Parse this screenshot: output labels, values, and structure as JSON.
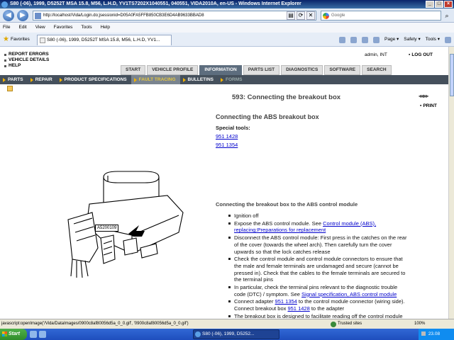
{
  "window": {
    "title": "S80 (-06), 1999, D5252T MSA 15.8, M56, L.H.D, YV1TS7202X1040551, 040551, VIDA2010A, en-US - Windows Internet Explorer",
    "url": "http://localhost/Vida/Login.do;jsessionid=D05A0FA5FFB850CB3E6D4AB9633BBAD8",
    "search_placeholder": "Google"
  },
  "menubar": [
    "File",
    "Edit",
    "View",
    "Favorites",
    "Tools",
    "Help"
  ],
  "favbar": {
    "favorites_label": "Favorites",
    "tab_title": "S80 (-06), 1999, D5252T MSA 15.8, M56, L.H.D, YV1...",
    "commands": [
      "Page ▾",
      "Safety ▾",
      "Tools ▾"
    ]
  },
  "toplinks": [
    "REPORT ERRORS",
    "VEHICLE DETAILS",
    "HELP"
  ],
  "user": "admin, INT",
  "logout": "LOG OUT",
  "main_tabs": [
    "START",
    "VEHICLE PROFILE",
    "INFORMATION",
    "PARTS LIST",
    "DIAGNOSTICS",
    "SOFTWARE",
    "SEARCH"
  ],
  "active_main_tab": "INFORMATION",
  "sub_tabs": [
    "PARTS",
    "REPAIR",
    "PRODUCT SPECIFICATIONS",
    "FAULT TRACING",
    "BULLETINS",
    "FORMS"
  ],
  "active_sub_tab": "FAULT TRACING",
  "figure_label": "A5200109",
  "content": {
    "title": "593: Connecting the breakout box",
    "nav_arrows": "◂◂ ▸▸",
    "print": "PRINT",
    "section_title": "Connecting the ABS breakout box",
    "special_tools_label": "Special tools:",
    "tools": [
      "951 1428",
      "951 1354"
    ],
    "sub_title": "Connecting the breakout box to the ABS control module",
    "steps": {
      "s1": "Ignition off",
      "s2_pre": "Expose the ABS control module. See ",
      "s2_link": "Control module (ABS), replacing:Preparations for replacement",
      "s3": "Disconnect the ABS control module: First press in the catches on the rear of the cover (towards the wheel arch). Then carefully turn the cover upwards so that the lock catches release",
      "s4": "Check the control module and control module connectors to ensure that the male and female terminals are undamaged and secure (cannot be pressed in). Check that the cables to the female terminals are secured to the terminal pins",
      "s5_pre": "In particular, check the terminal pins relevant to the diagnostic trouble code (DTC) / symptom. See ",
      "s5_link": "Signal specification, ABS control module",
      "s6_pre": "Connect adapter ",
      "s6_link1": "951 1354",
      "s6_mid": " to the control module connector (wiring side). Connect breakout box ",
      "s6_link2": "951 1428",
      "s6_post": " to the adapter",
      "s7": "The breakout box is designed to facilitate reading off the control module input and output signals when the control module is connected; and cable and"
    }
  },
  "statusbar": {
    "text": "javascript:openImage('/Vida/DataImages/0900c8af80056d5a_0_0.gif', '0900c8af80056d5a_0_0.gif')",
    "trusted": "Trusted sites",
    "zoom": "100%"
  },
  "taskbar": {
    "start": "Start",
    "task": "S80 (-06), 1999, D5252...",
    "clock": "23.08"
  }
}
